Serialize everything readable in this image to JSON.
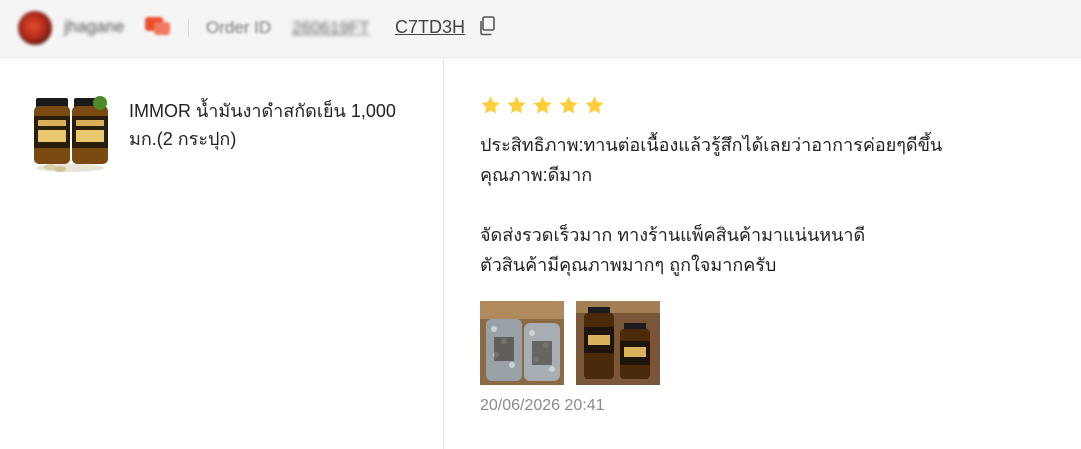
{
  "header": {
    "username": "jhagane",
    "avatar_icon": "avatar",
    "chat_icon": "chat-icon",
    "order_label": "Order ID",
    "order_id_hidden": "260619FT",
    "order_id_visible": "C7TD3H",
    "copy_icon": "copy-icon"
  },
  "product": {
    "name": "IMMOR น้ำมันงาดำสกัดเย็น 1,000 มก.(2 กระปุก)"
  },
  "review": {
    "rating": 5,
    "max_rating": 5,
    "star_color": "#ffce3d",
    "lines": [
      "ประสิทธิภาพ:ทานต่อเนื้องแล้วรู้สึกได้เลยว่าอาการค่อยๆดีขึ้น",
      "คุณภาพ:ดีมาก",
      "",
      "จัดส่งรวดเร็วมาก ทางร้านแพ็คสินค้ามาแน่นหนาดี",
      "ตัวสินค้ามีคุณภาพมากๆ ถูกใจมากครับ"
    ],
    "timestamp": "20/06/2026 20:41"
  }
}
